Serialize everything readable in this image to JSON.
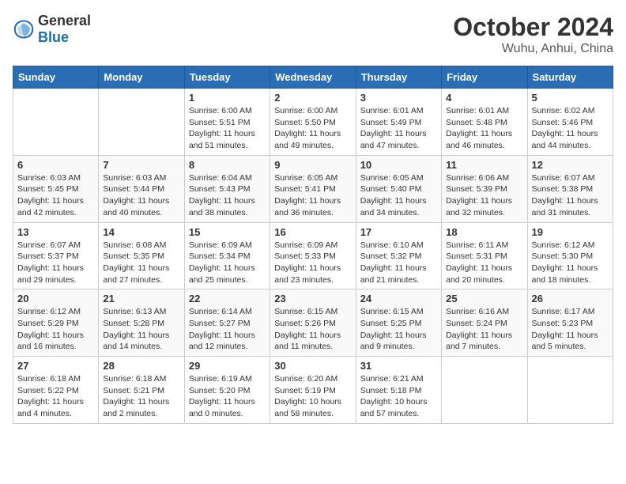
{
  "logo": {
    "general": "General",
    "blue": "Blue"
  },
  "title": "October 2024",
  "location": "Wuhu, Anhui, China",
  "weekdays": [
    "Sunday",
    "Monday",
    "Tuesday",
    "Wednesday",
    "Thursday",
    "Friday",
    "Saturday"
  ],
  "weeks": [
    [
      {
        "day": "",
        "sunrise": "",
        "sunset": "",
        "daylight": ""
      },
      {
        "day": "",
        "sunrise": "",
        "sunset": "",
        "daylight": ""
      },
      {
        "day": "1",
        "sunrise": "Sunrise: 6:00 AM",
        "sunset": "Sunset: 5:51 PM",
        "daylight": "Daylight: 11 hours and 51 minutes."
      },
      {
        "day": "2",
        "sunrise": "Sunrise: 6:00 AM",
        "sunset": "Sunset: 5:50 PM",
        "daylight": "Daylight: 11 hours and 49 minutes."
      },
      {
        "day": "3",
        "sunrise": "Sunrise: 6:01 AM",
        "sunset": "Sunset: 5:49 PM",
        "daylight": "Daylight: 11 hours and 47 minutes."
      },
      {
        "day": "4",
        "sunrise": "Sunrise: 6:01 AM",
        "sunset": "Sunset: 5:48 PM",
        "daylight": "Daylight: 11 hours and 46 minutes."
      },
      {
        "day": "5",
        "sunrise": "Sunrise: 6:02 AM",
        "sunset": "Sunset: 5:46 PM",
        "daylight": "Daylight: 11 hours and 44 minutes."
      }
    ],
    [
      {
        "day": "6",
        "sunrise": "Sunrise: 6:03 AM",
        "sunset": "Sunset: 5:45 PM",
        "daylight": "Daylight: 11 hours and 42 minutes."
      },
      {
        "day": "7",
        "sunrise": "Sunrise: 6:03 AM",
        "sunset": "Sunset: 5:44 PM",
        "daylight": "Daylight: 11 hours and 40 minutes."
      },
      {
        "day": "8",
        "sunrise": "Sunrise: 6:04 AM",
        "sunset": "Sunset: 5:43 PM",
        "daylight": "Daylight: 11 hours and 38 minutes."
      },
      {
        "day": "9",
        "sunrise": "Sunrise: 6:05 AM",
        "sunset": "Sunset: 5:41 PM",
        "daylight": "Daylight: 11 hours and 36 minutes."
      },
      {
        "day": "10",
        "sunrise": "Sunrise: 6:05 AM",
        "sunset": "Sunset: 5:40 PM",
        "daylight": "Daylight: 11 hours and 34 minutes."
      },
      {
        "day": "11",
        "sunrise": "Sunrise: 6:06 AM",
        "sunset": "Sunset: 5:39 PM",
        "daylight": "Daylight: 11 hours and 32 minutes."
      },
      {
        "day": "12",
        "sunrise": "Sunrise: 6:07 AM",
        "sunset": "Sunset: 5:38 PM",
        "daylight": "Daylight: 11 hours and 31 minutes."
      }
    ],
    [
      {
        "day": "13",
        "sunrise": "Sunrise: 6:07 AM",
        "sunset": "Sunset: 5:37 PM",
        "daylight": "Daylight: 11 hours and 29 minutes."
      },
      {
        "day": "14",
        "sunrise": "Sunrise: 6:08 AM",
        "sunset": "Sunset: 5:35 PM",
        "daylight": "Daylight: 11 hours and 27 minutes."
      },
      {
        "day": "15",
        "sunrise": "Sunrise: 6:09 AM",
        "sunset": "Sunset: 5:34 PM",
        "daylight": "Daylight: 11 hours and 25 minutes."
      },
      {
        "day": "16",
        "sunrise": "Sunrise: 6:09 AM",
        "sunset": "Sunset: 5:33 PM",
        "daylight": "Daylight: 11 hours and 23 minutes."
      },
      {
        "day": "17",
        "sunrise": "Sunrise: 6:10 AM",
        "sunset": "Sunset: 5:32 PM",
        "daylight": "Daylight: 11 hours and 21 minutes."
      },
      {
        "day": "18",
        "sunrise": "Sunrise: 6:11 AM",
        "sunset": "Sunset: 5:31 PM",
        "daylight": "Daylight: 11 hours and 20 minutes."
      },
      {
        "day": "19",
        "sunrise": "Sunrise: 6:12 AM",
        "sunset": "Sunset: 5:30 PM",
        "daylight": "Daylight: 11 hours and 18 minutes."
      }
    ],
    [
      {
        "day": "20",
        "sunrise": "Sunrise: 6:12 AM",
        "sunset": "Sunset: 5:29 PM",
        "daylight": "Daylight: 11 hours and 16 minutes."
      },
      {
        "day": "21",
        "sunrise": "Sunrise: 6:13 AM",
        "sunset": "Sunset: 5:28 PM",
        "daylight": "Daylight: 11 hours and 14 minutes."
      },
      {
        "day": "22",
        "sunrise": "Sunrise: 6:14 AM",
        "sunset": "Sunset: 5:27 PM",
        "daylight": "Daylight: 11 hours and 12 minutes."
      },
      {
        "day": "23",
        "sunrise": "Sunrise: 6:15 AM",
        "sunset": "Sunset: 5:26 PM",
        "daylight": "Daylight: 11 hours and 11 minutes."
      },
      {
        "day": "24",
        "sunrise": "Sunrise: 6:15 AM",
        "sunset": "Sunset: 5:25 PM",
        "daylight": "Daylight: 11 hours and 9 minutes."
      },
      {
        "day": "25",
        "sunrise": "Sunrise: 6:16 AM",
        "sunset": "Sunset: 5:24 PM",
        "daylight": "Daylight: 11 hours and 7 minutes."
      },
      {
        "day": "26",
        "sunrise": "Sunrise: 6:17 AM",
        "sunset": "Sunset: 5:23 PM",
        "daylight": "Daylight: 11 hours and 5 minutes."
      }
    ],
    [
      {
        "day": "27",
        "sunrise": "Sunrise: 6:18 AM",
        "sunset": "Sunset: 5:22 PM",
        "daylight": "Daylight: 11 hours and 4 minutes."
      },
      {
        "day": "28",
        "sunrise": "Sunrise: 6:18 AM",
        "sunset": "Sunset: 5:21 PM",
        "daylight": "Daylight: 11 hours and 2 minutes."
      },
      {
        "day": "29",
        "sunrise": "Sunrise: 6:19 AM",
        "sunset": "Sunset: 5:20 PM",
        "daylight": "Daylight: 11 hours and 0 minutes."
      },
      {
        "day": "30",
        "sunrise": "Sunrise: 6:20 AM",
        "sunset": "Sunset: 5:19 PM",
        "daylight": "Daylight: 10 hours and 58 minutes."
      },
      {
        "day": "31",
        "sunrise": "Sunrise: 6:21 AM",
        "sunset": "Sunset: 5:18 PM",
        "daylight": "Daylight: 10 hours and 57 minutes."
      },
      {
        "day": "",
        "sunrise": "",
        "sunset": "",
        "daylight": ""
      },
      {
        "day": "",
        "sunrise": "",
        "sunset": "",
        "daylight": ""
      }
    ]
  ]
}
